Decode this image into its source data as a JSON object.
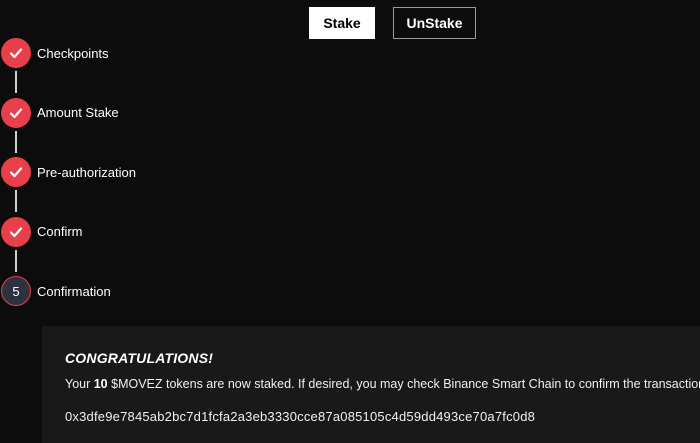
{
  "tabs": {
    "stake_label": "Stake",
    "unstake_label": "UnStake"
  },
  "steps": [
    {
      "label": "Checkpoints",
      "status": "done",
      "icon": "check-icon"
    },
    {
      "label": "Amount Stake",
      "status": "done",
      "icon": "check-icon"
    },
    {
      "label": "Pre-authorization",
      "status": "done",
      "icon": "check-icon"
    },
    {
      "label": "Confirm",
      "status": "done",
      "icon": "check-icon"
    },
    {
      "label": "Confirmation",
      "status": "current",
      "number": "5"
    }
  ],
  "congrats": {
    "title": "CONGRATULATIONS!",
    "message_prefix": "Your ",
    "amount": "10",
    "message_suffix": " $MOVEZ tokens are now staked. If desired, you may check Binance Smart Chain to confirm the transaction.",
    "tx_hash": "0x3dfe9e7845ab2bc7d1fcfa2a3eb3330cce87a085105c4d59dd493ce70a7fc0d8"
  },
  "colors": {
    "accent": "#e8404a",
    "background": "#0c0c0c",
    "panel": "#191919",
    "current_step_fill": "#2d3140"
  }
}
